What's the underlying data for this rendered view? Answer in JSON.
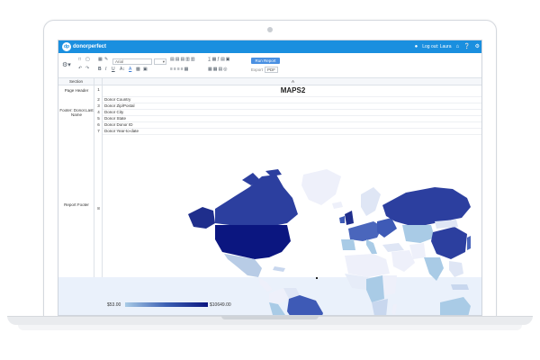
{
  "app": {
    "brand_badge": "dp",
    "brand_name": "donorperfect",
    "logout_label": "Log out: Laura"
  },
  "toolbar": {
    "font_value": "Arial",
    "size_value": "",
    "run_label": "Run Report",
    "export_label": "Export",
    "export_value": "PDF"
  },
  "table": {
    "section_header": "Section",
    "col_header": "A"
  },
  "rows": {
    "page_header_label": "Page Header",
    "footer_label": "Footer: Donor.Last Name",
    "report_footer_label": "Report Footer",
    "title": "MAPS2",
    "nums": [
      "1",
      "2",
      "3",
      "4",
      "5",
      "6",
      "7",
      "8"
    ],
    "fields": [
      "Donor Country",
      "Donor Zip/Postal",
      "Donor City",
      "Donor State",
      "Donor Donor ID",
      "Donor Year-to-date"
    ]
  },
  "legend": {
    "min_label": "$53.00",
    "max_label": "$10649.00",
    "color_min": "#a9cbe6",
    "color_max": "#0b1680"
  },
  "colors": {
    "brand": "#1a8fdf",
    "accent": "#4a90e2"
  },
  "icons": [
    "home-icon",
    "help-icon",
    "settings-icon",
    "user-icon",
    "gear-icon",
    "save-icon",
    "undo-icon",
    "redo-icon"
  ]
}
